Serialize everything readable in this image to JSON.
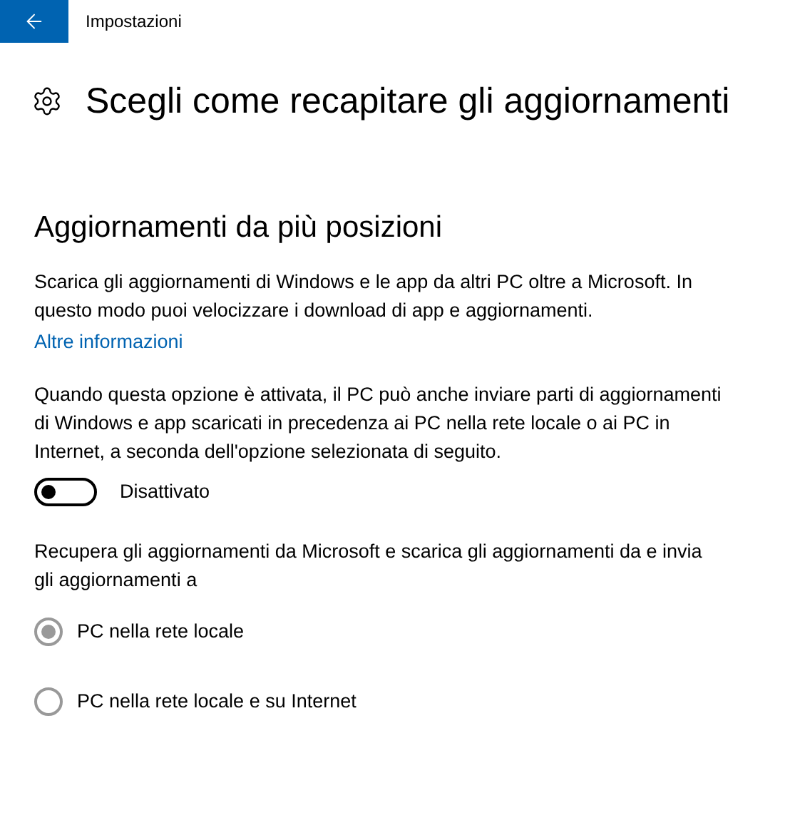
{
  "window": {
    "title": "Impostazioni"
  },
  "page_title": "Scegli come recapitare gli aggiornamenti",
  "section": {
    "heading": "Aggiornamenti da più posizioni",
    "description": "Scarica gli aggiornamenti di Windows e le app da altri PC oltre a Microsoft. In questo modo puoi velocizzare i download di app e aggiornamenti.",
    "link": "Altre informazioni",
    "toggle_description": "Quando questa opzione è attivata, il PC può anche inviare parti di aggiornamenti di Windows e app scaricati in precedenza ai PC nella rete locale o ai PC in Internet, a seconda dell'opzione selezionata di seguito.",
    "toggle": {
      "on": false,
      "label": "Disattivato"
    },
    "options_description": "Recupera gli aggiornamenti da Microsoft e scarica gli aggiornamenti da e invia gli aggiornamenti a",
    "options": [
      {
        "label": "PC nella rete locale",
        "selected": true
      },
      {
        "label": "PC nella rete locale e su Internet",
        "selected": false
      }
    ]
  }
}
